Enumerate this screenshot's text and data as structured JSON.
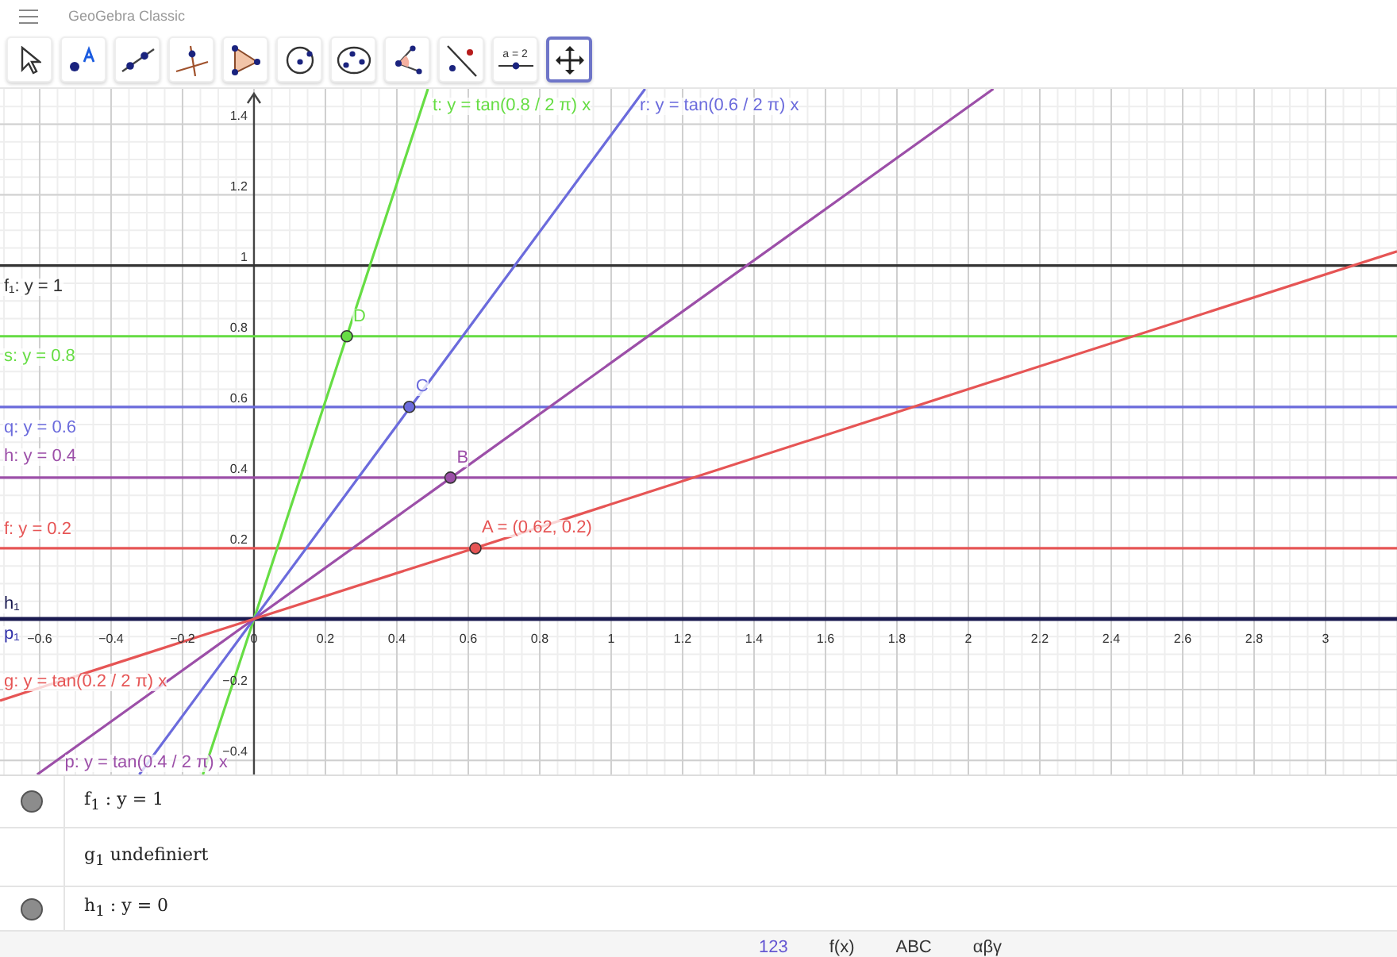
{
  "header": {
    "title": "GeoGebra Classic"
  },
  "toolbar": {
    "tools": [
      {
        "kind": "move",
        "selected": false
      },
      {
        "kind": "point",
        "selected": false
      },
      {
        "kind": "line",
        "selected": false
      },
      {
        "kind": "perpendicular",
        "selected": false
      },
      {
        "kind": "polygon",
        "selected": false
      },
      {
        "kind": "circle",
        "selected": false
      },
      {
        "kind": "conic",
        "selected": false
      },
      {
        "kind": "angle",
        "selected": false
      },
      {
        "kind": "reflect",
        "selected": false
      },
      {
        "kind": "slider",
        "selected": false,
        "text": "a = 2"
      },
      {
        "kind": "move_view",
        "selected": true
      }
    ]
  },
  "graphics": {
    "chart_data": {
      "type": "line",
      "ylabel": "p₁",
      "x": [
        -0.711,
        -0.607,
        -0.321,
        -0.143,
        0,
        0.487,
        1.095,
        2.07,
        3.2
      ],
      "grid": true,
      "xlim": [
        -0.711,
        3.2
      ],
      "ylim": [
        -0.44,
        1.5
      ],
      "series": [
        {
          "name": "f₁: y = 1",
          "color": "#333333",
          "values": [
            1,
            1,
            1,
            1,
            1,
            1,
            1,
            1,
            1
          ]
        },
        {
          "name": "s: y = 0.8",
          "color": "#66dd44",
          "values": [
            0.8,
            0.8,
            0.8,
            0.8,
            0.8,
            0.8,
            0.8,
            0.8,
            0.8
          ]
        },
        {
          "name": "q: y = 0.6",
          "color": "#6b6bdc",
          "values": [
            0.6,
            0.6,
            0.6,
            0.6,
            0.6,
            0.6,
            0.6,
            0.6,
            0.6
          ]
        },
        {
          "name": "h: y = 0.4",
          "color": "#9c4fa8",
          "values": [
            0.4,
            0.4,
            0.4,
            0.4,
            0.4,
            0.4,
            0.4,
            0.4,
            0.4
          ]
        },
        {
          "name": "f: y = 0.2",
          "color": "#e65555",
          "values": [
            0.2,
            0.2,
            0.2,
            0.2,
            0.2,
            0.2,
            0.2,
            0.2,
            0.2
          ]
        },
        {
          "name": "h₁",
          "color": "#1a1a50",
          "values": [
            0,
            0,
            0,
            0,
            0,
            0,
            0,
            0,
            0
          ]
        },
        {
          "name": "t: y = tan(0.8 / 2 π) x",
          "color": "#66dd44",
          "values": [
            null,
            null,
            null,
            -0.44,
            0,
            1.5,
            null,
            null,
            null
          ]
        },
        {
          "name": "r: y = tan(0.6 / 2 π) x",
          "color": "#6b6bdc",
          "values": [
            null,
            null,
            -0.44,
            -0.196,
            0,
            0.667,
            1.5,
            null,
            null
          ]
        },
        {
          "name": "p: y = tan(0.4 / 2 π) x",
          "color": "#9c4fa8",
          "values": [
            null,
            -0.44,
            -0.233,
            -0.104,
            0,
            0.353,
            0.794,
            1.5,
            null
          ]
        },
        {
          "name": "g: y = tan(0.2 / 2 π) x",
          "color": "#e65555",
          "values": [
            -0.231,
            -0.197,
            -0.104,
            -0.046,
            0,
            0.158,
            0.356,
            0.673,
            1.04
          ]
        }
      ],
      "xticks": [
        {
          "value": -0.6,
          "label": "−0.6"
        },
        {
          "value": -0.4,
          "label": "−0.4"
        },
        {
          "value": -0.2,
          "label": "−0.2"
        },
        0,
        0.2,
        0.4,
        0.6,
        0.8,
        1,
        1.2,
        1.4,
        1.6,
        1.8,
        2,
        2.2,
        2.4,
        2.6,
        2.8,
        3
      ],
      "yticks": [
        {
          "value": -0.4,
          "label": "−0.4"
        },
        {
          "value": -0.2,
          "label": "−0.2"
        },
        0.2,
        0.4,
        0.6,
        0.8,
        1,
        1.2,
        1.4
      ],
      "annotations": [
        {
          "text": "A = (0.62, 0.2)",
          "x": 0.62,
          "y": 0.2
        },
        {
          "text": "B",
          "x": 0.55,
          "y": 0.4
        },
        {
          "text": "C",
          "x": 0.435,
          "y": 0.6
        },
        {
          "text": "D",
          "x": 0.26,
          "y": 0.8
        }
      ]
    }
  },
  "algebra": {
    "rows": [
      {
        "kind": "object",
        "visible": true,
        "text": "f$_{1}$ : y = 1"
      },
      {
        "kind": "undefined",
        "text": "g$_{1}$ undefiniert"
      },
      {
        "kind": "object",
        "visible": true,
        "text": "h$_{1}$ : y = 0"
      }
    ]
  },
  "keyboard": {
    "tabs": [
      {
        "label": "123",
        "selected": true
      },
      {
        "label": "f(x)",
        "selected": false
      },
      {
        "label": "ABC",
        "selected": false
      },
      {
        "label": "αβγ",
        "selected": false
      }
    ]
  }
}
